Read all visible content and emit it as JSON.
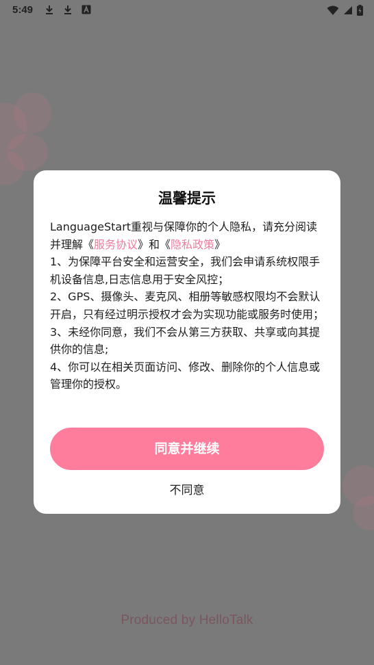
{
  "status_bar": {
    "time": "5:49",
    "icons_left": [
      "download-icon",
      "download-icon",
      "a-badge-icon"
    ],
    "icons_right": [
      "wifi-icon",
      "signal-icon",
      "battery-icon"
    ]
  },
  "dialog": {
    "title": "温馨提示",
    "intro_prefix": "LanguageStart重视与保障你的个人隐私，请充分阅读并理解《",
    "service_link": "服务协议",
    "intro_middle": "》和《",
    "privacy_link": "隐私政策",
    "intro_suffix": "》",
    "items": [
      "1、为保障平台安全和运营安全，我们会申请系统权限手机设备信息,日志信息用于安全风控；",
      "2、GPS、摄像头、麦克风、相册等敏感权限均不会默认开启，只有经过明示授权才会为实现功能或服务时使用；",
      "3、未经你同意，我们不会从第三方获取、共享或向其提供你的信息;",
      "4、你可以在相关页面访问、修改、删除你的个人信息或管理你的授权。"
    ],
    "agree_label": "同意并继续",
    "disagree_label": "不同意"
  },
  "footer": {
    "produced_by": "Produced by HelloTalk"
  },
  "colors": {
    "accent": "#ff7d9c",
    "link": "#ee7d9c",
    "overlay": "#7a7a7a"
  }
}
